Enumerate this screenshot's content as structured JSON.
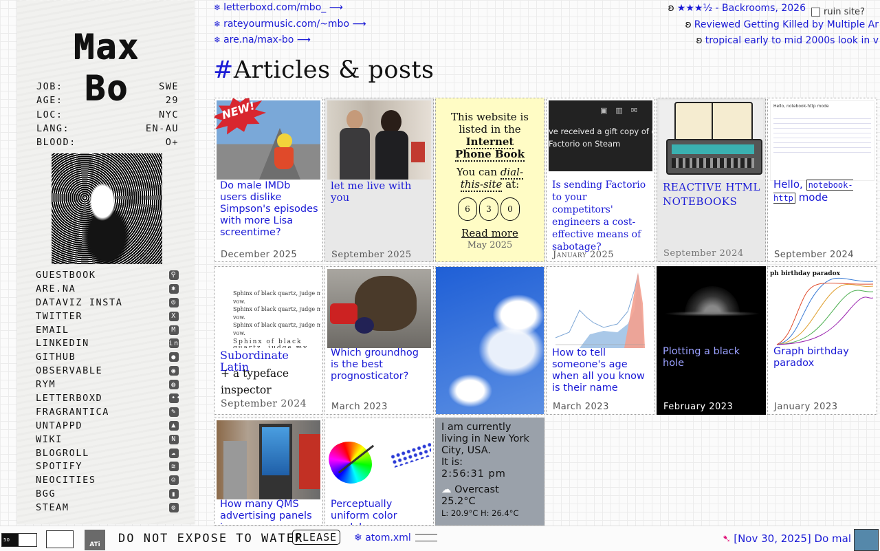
{
  "site": {
    "title": "Max Bo"
  },
  "stats": [
    {
      "key": "JOB:",
      "value": "SWE"
    },
    {
      "key": "AGE:",
      "value": "29"
    },
    {
      "key": "LOC:",
      "value": "NYC"
    },
    {
      "key": "LANG:",
      "value": "EN-AU"
    },
    {
      "key": "BLOOD:",
      "value": "O+"
    }
  ],
  "links": [
    {
      "label": "GUESTBOOK",
      "icon": "guestbook-icon",
      "glyph": "⚲"
    },
    {
      "label": "ARE.NA",
      "icon": "arena-icon",
      "glyph": "✱"
    },
    {
      "label": "DATAVIZ INSTA",
      "icon": "instagram-icon",
      "glyph": "◎"
    },
    {
      "label": "TWITTER",
      "icon": "x-icon",
      "glyph": "X"
    },
    {
      "label": "EMAIL",
      "icon": "mail-icon",
      "glyph": "M"
    },
    {
      "label": "LINKEDIN",
      "icon": "linkedin-icon",
      "glyph": "in"
    },
    {
      "label": "GITHUB",
      "icon": "github-icon",
      "glyph": "●"
    },
    {
      "label": "OBSERVABLE",
      "icon": "observable-icon",
      "glyph": "◉"
    },
    {
      "label": "RYM",
      "icon": "rym-icon",
      "glyph": "◍"
    },
    {
      "label": "LETTERBOXD",
      "icon": "letterboxd-icon",
      "glyph": "•••"
    },
    {
      "label": "FRAGRANTICA",
      "icon": "fragrantica-icon",
      "glyph": "✎"
    },
    {
      "label": "UNTAPPD",
      "icon": "untappd-icon",
      "glyph": "▲"
    },
    {
      "label": "WIKI",
      "icon": "notion-icon",
      "glyph": "N"
    },
    {
      "label": "BLOGROLL",
      "icon": "blogroll-icon",
      "glyph": "☁"
    },
    {
      "label": "SPOTIFY",
      "icon": "spotify-icon",
      "glyph": "≋"
    },
    {
      "label": "NEOCITIES",
      "icon": "neocities-icon",
      "glyph": "☺"
    },
    {
      "label": "BGG",
      "icon": "bgg-icon",
      "glyph": "▮"
    },
    {
      "label": "STEAM",
      "icon": "steam-icon",
      "glyph": "⚙"
    }
  ],
  "feeds_left": [
    {
      "bullet": "❄",
      "text": "letterboxd.com/mbo_",
      "arrow": "⟶"
    },
    {
      "bullet": "❄",
      "text": "rateyourmusic.com/~mbo",
      "arrow": "⟶"
    },
    {
      "bullet": "❄",
      "text": "are.na/max-bo",
      "arrow": "⟶"
    }
  ],
  "feeds_right": [
    {
      "pre": "ʚ",
      "text": "★★★½ - Backrooms, 2026"
    },
    {
      "pre": "ʚ",
      "text": "Reviewed Getting Killed by Multiple Ar"
    },
    {
      "pre": "ʚ",
      "text": "tropical early to mid 2000s look in v"
    }
  ],
  "ruin_site": "ruin site?",
  "heading": {
    "hash": "#",
    "text": "Articles & posts"
  },
  "cards": [
    {
      "title": "Do male IMDb users dislike Simpson's episodes with more Lisa screentime?",
      "date": "December 2025",
      "badge": "NEW!"
    },
    {
      "title": "let me live with you",
      "date": "September 2025"
    },
    {
      "line1": "This website is listed in the",
      "bold": "Internet Phone Book",
      "line2": "You can",
      "italic": "dial-this-site",
      "line3": "at:",
      "digits": [
        "6",
        "3",
        "0"
      ],
      "more": "Read more",
      "date": "May 2025"
    },
    {
      "title": "Is sending Factorio to your competitors' engineers a cost-effective means of sabotage?",
      "date": "January 2025",
      "thumb_text": "ve received a gift copy of game Factorio on Steam"
    },
    {
      "title": "REACTIVE HTML NOTEBOOKS",
      "date": "September 2024"
    },
    {
      "title_a": "Hello,",
      "title_code": "notebook-http",
      "title_b": "mode",
      "date": "September 2024",
      "thumb_title": "Hello, notebook-http mode"
    },
    {
      "title": "Subordinate Latin",
      "subtitle": "+ a typeface inspector",
      "date": "September 2024",
      "sample": "Sphinx of black quartz, judge my vow."
    },
    {
      "title": "Which groundhog is the best prognosticator?",
      "date": "March 2023"
    },
    {
      "title": "",
      "date": ""
    },
    {
      "title": "How to tell someone's age when all you know is their name",
      "date": "March 2023"
    },
    {
      "title": "Plotting a black hole",
      "date": "February 2023"
    },
    {
      "title": "Graph birthday paradox",
      "date": "January 2023",
      "thumb_title": "ph birthday paradox"
    },
    {
      "title": "How many QMS advertising panels in...",
      "date": ""
    },
    {
      "title": "Perceptually uniform color models",
      "date": ""
    },
    {
      "l1": "I am currently living in New York City, USA.",
      "l2": "It is:",
      "time": "2:56:31 pm",
      "cond": "Overcast",
      "temp": "25.2°C",
      "range": "L: 20.9°C H: 26.4°C"
    }
  ],
  "bottom": {
    "mini_slider": "50",
    "ati": "ATi",
    "water": "DO NOT EXPOSE TO WATER",
    "please": "PLEASE",
    "atom": "atom.xml",
    "ticker": "[Nov 30, 2025] Do mal"
  }
}
